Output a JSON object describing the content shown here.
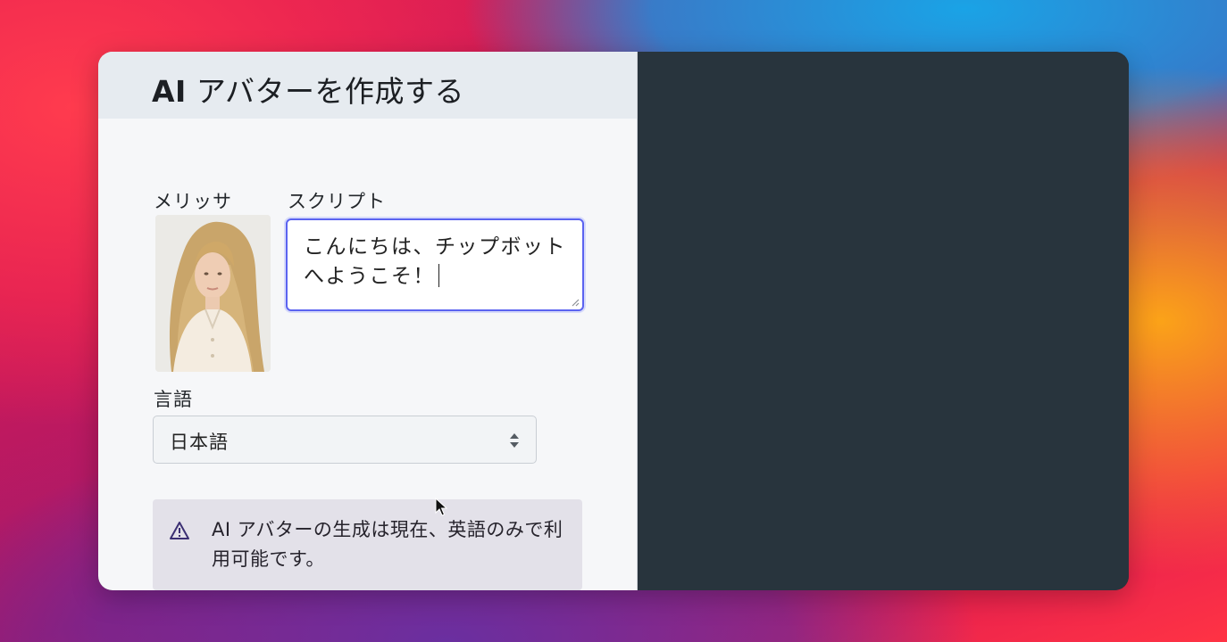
{
  "window": {
    "title_prefix": "AI",
    "title_rest": " アバターを作成する"
  },
  "avatar": {
    "name_label": "メリッサ"
  },
  "script": {
    "label": "スクリプト",
    "value": "こんにちは、チップボットへようこそ！"
  },
  "language": {
    "label": "言語",
    "selected": "日本語"
  },
  "notice": {
    "text": "AI アバターの生成は現在、英語のみで利用可能です。",
    "icon": "warning-icon"
  },
  "colors": {
    "accent": "#5b63f0",
    "right_panel": "#28343d",
    "notice_bg": "#e3e1e9"
  }
}
